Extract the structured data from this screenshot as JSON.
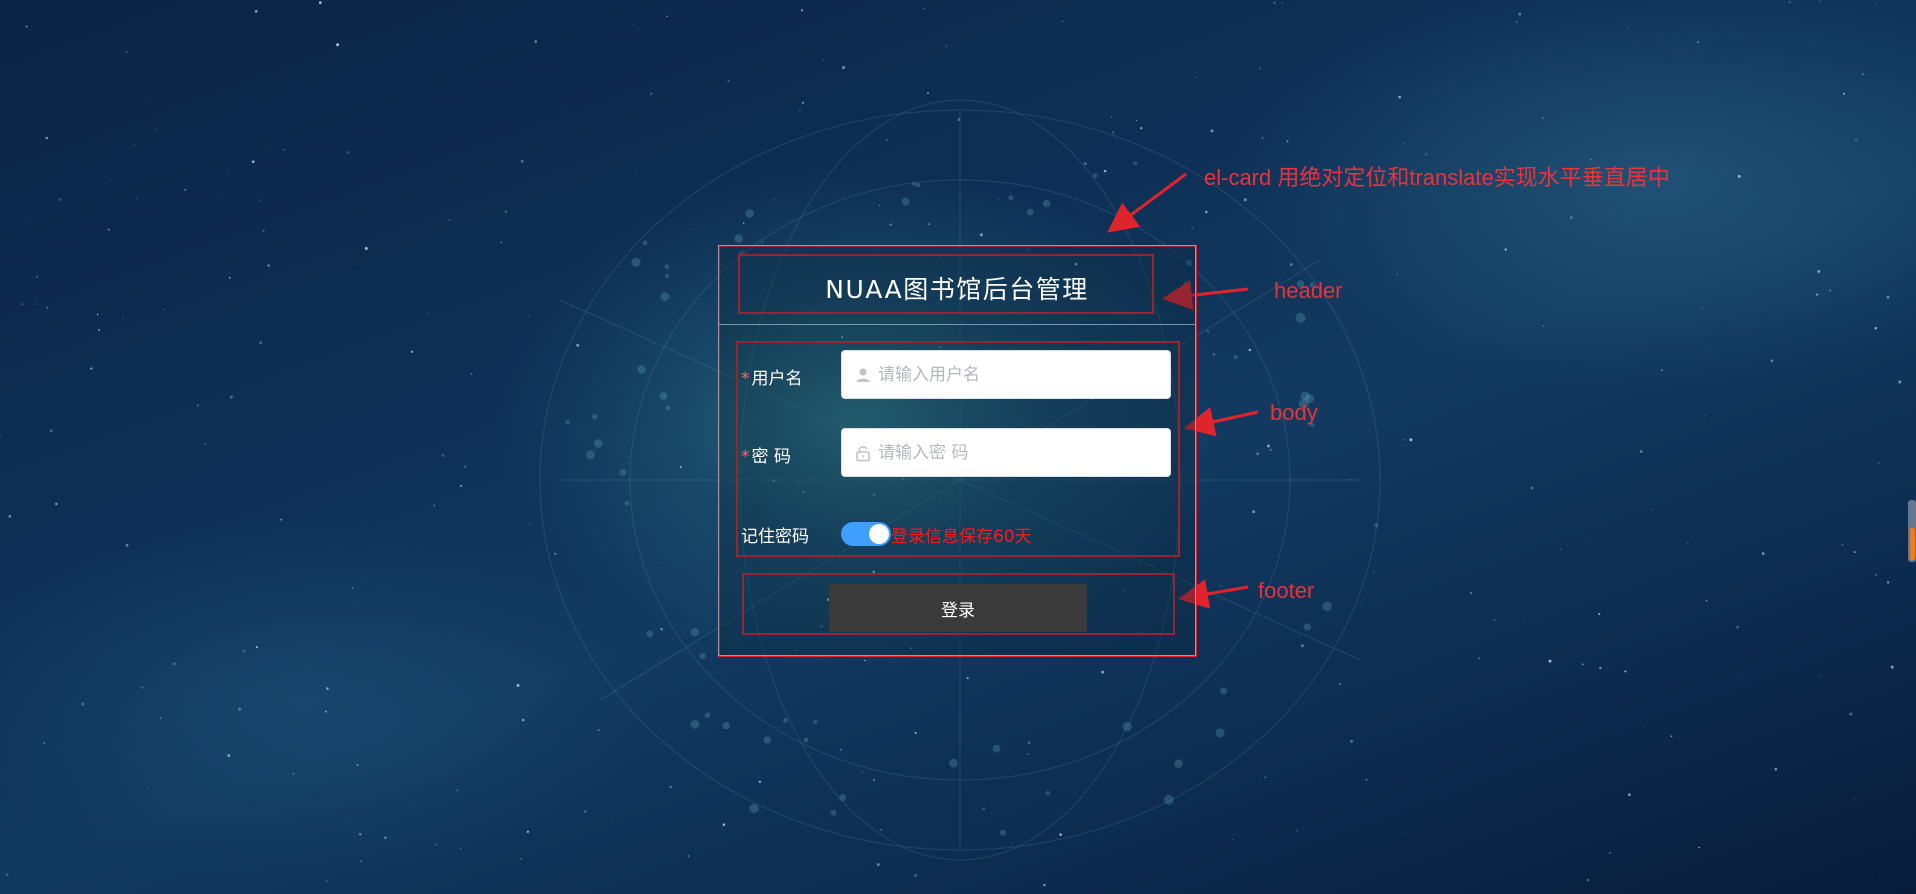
{
  "card": {
    "title": "NUAA图书馆后台管理"
  },
  "form": {
    "username": {
      "required_mark": "*",
      "label": "用户名",
      "placeholder": "请输入用户名",
      "value": "",
      "icon": "user-icon"
    },
    "password": {
      "required_mark": "*",
      "label": "密 码",
      "placeholder": "请输入密 码",
      "value": "",
      "icon": "lock-icon"
    },
    "remember": {
      "label": "记住密码",
      "switch_on": true,
      "switch_text": "登录信息保存60天"
    }
  },
  "footer": {
    "login_label": "登录"
  },
  "annotations": {
    "card_note": "el-card 用绝对定位和translate实现水平垂直居中",
    "header": "header",
    "body": "body",
    "footer": "footer"
  },
  "colors": {
    "annotation": "#e0242c",
    "switch_active": "#409eff",
    "switch_text": "#ff1a1a",
    "button_bg": "#3a3a3a",
    "required_mark": "#f56c6c"
  }
}
